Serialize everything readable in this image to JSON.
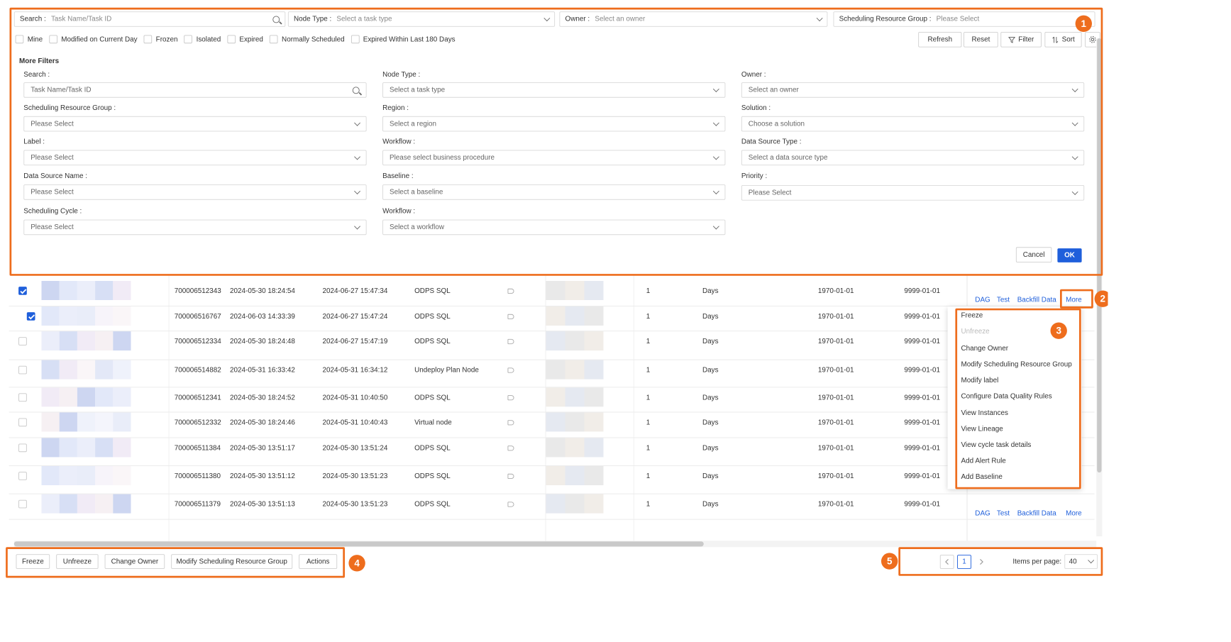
{
  "filters": {
    "search_label": "Search :",
    "search_placeholder": "Task Name/Task ID",
    "node_type_label": "Node Type :",
    "node_type_placeholder": "Select a task type",
    "owner_label": "Owner :",
    "owner_placeholder": "Select an owner",
    "resource_group_label": "Scheduling Resource Group :",
    "resource_group_placeholder": "Please Select"
  },
  "quick_filters": [
    {
      "label": "Mine",
      "checked": false
    },
    {
      "label": "Modified on Current Day",
      "checked": false
    },
    {
      "label": "Frozen",
      "checked": false
    },
    {
      "label": "Isolated",
      "checked": false
    },
    {
      "label": "Expired",
      "checked": false
    },
    {
      "label": "Normally Scheduled",
      "checked": false
    },
    {
      "label": "Expired Within Last 180 Days",
      "checked": false
    }
  ],
  "toolbar": {
    "refresh": "Refresh",
    "reset": "Reset",
    "filter": "Filter",
    "sort": "Sort"
  },
  "more_filters": {
    "title": "More Filters",
    "fields": [
      {
        "label": "Search :",
        "placeholder": "Task Name/Task ID"
      },
      {
        "label": "Node Type :",
        "placeholder": "Select a task type"
      },
      {
        "label": "Owner :",
        "placeholder": "Select an owner"
      },
      {
        "label": "Scheduling Resource Group :",
        "placeholder": "Please Select"
      },
      {
        "label": "Region :",
        "placeholder": "Select a region"
      },
      {
        "label": "Solution :",
        "placeholder": "Choose a solution"
      },
      {
        "label": "Label :",
        "placeholder": "Please Select"
      },
      {
        "label": "Workflow :",
        "placeholder": "Please select business procedure"
      },
      {
        "label": "Data Source Type :",
        "placeholder": "Select a data source type"
      },
      {
        "label": "Data Source Name :",
        "placeholder": "Please Select"
      },
      {
        "label": "Baseline :",
        "placeholder": "Select a baseline"
      },
      {
        "label": "Priority :",
        "placeholder": "Please Select"
      },
      {
        "label": "Scheduling Cycle :",
        "placeholder": "Please Select"
      },
      {
        "label": "Workflow :",
        "placeholder": "Select a workflow"
      }
    ],
    "cancel": "Cancel",
    "ok": "OK"
  },
  "rows": [
    {
      "checked": true,
      "id": "700006512343",
      "created": "2024-05-30 18:24:54",
      "modified": "2024-06-27 15:47:34",
      "type": "ODPS SQL",
      "priority": "1",
      "cycle": "Days",
      "start": "1970-01-01",
      "end": "9999-01-01"
    },
    {
      "checked": true,
      "id": "700006516767",
      "created": "2024-06-03 14:33:39",
      "modified": "2024-06-27 15:47:24",
      "type": "ODPS SQL",
      "priority": "1",
      "cycle": "Days",
      "start": "1970-01-01",
      "end": "9999-01-01"
    },
    {
      "checked": false,
      "id": "700006512334",
      "created": "2024-05-30 18:24:48",
      "modified": "2024-06-27 15:47:19",
      "type": "ODPS SQL",
      "priority": "1",
      "cycle": "Days",
      "start": "1970-01-01",
      "end": "9999-01-01"
    },
    {
      "checked": false,
      "id": "700006514882",
      "created": "2024-05-31 16:33:42",
      "modified": "2024-05-31 16:34:12",
      "type": "Undeploy Plan Node",
      "priority": "1",
      "cycle": "Days",
      "start": "1970-01-01",
      "end": "9999-01-01"
    },
    {
      "checked": false,
      "id": "700006512341",
      "created": "2024-05-30 18:24:52",
      "modified": "2024-05-31 10:40:50",
      "type": "ODPS SQL",
      "priority": "1",
      "cycle": "Days",
      "start": "1970-01-01",
      "end": "9999-01-01"
    },
    {
      "checked": false,
      "id": "700006512332",
      "created": "2024-05-30 18:24:46",
      "modified": "2024-05-31 10:40:43",
      "type": "Virtual node",
      "priority": "1",
      "cycle": "Days",
      "start": "1970-01-01",
      "end": "9999-01-01"
    },
    {
      "checked": false,
      "id": "700006511384",
      "created": "2024-05-30 13:51:17",
      "modified": "2024-05-30 13:51:24",
      "type": "ODPS SQL",
      "priority": "1",
      "cycle": "Days",
      "start": "1970-01-01",
      "end": "9999-01-01"
    },
    {
      "checked": false,
      "id": "700006511380",
      "created": "2024-05-30 13:51:12",
      "modified": "2024-05-30 13:51:23",
      "type": "ODPS SQL",
      "priority": "1",
      "cycle": "Days",
      "start": "1970-01-01",
      "end": "9999-01-01"
    },
    {
      "checked": false,
      "id": "700006511379",
      "created": "2024-05-30 13:51:13",
      "modified": "2024-05-30 13:51:23",
      "type": "ODPS SQL",
      "priority": "1",
      "cycle": "Days",
      "start": "1970-01-01",
      "end": "9999-01-01"
    }
  ],
  "row_actions": {
    "dag": "DAG",
    "test": "Test",
    "backfill": "Backfill Data",
    "more": "More"
  },
  "more_menu": [
    "Freeze",
    "Unfreeze",
    "Change Owner",
    "Modify Scheduling Resource Group",
    "Modify label",
    "Configure Data Quality Rules",
    "View Instances",
    "View Lineage",
    "View cycle task details",
    "Add Alert Rule",
    "Add Baseline"
  ],
  "bulk_actions": [
    "Freeze",
    "Unfreeze",
    "Change Owner",
    "Modify Scheduling Resource Group",
    "Actions"
  ],
  "pagination": {
    "current_page": "1",
    "items_per_page_label": "Items per page:",
    "items_per_page": "40"
  },
  "callouts": [
    "1",
    "2",
    "3",
    "4",
    "5"
  ],
  "colors": {
    "accent": "#1f5fdb",
    "callout": "#ee6d1d"
  }
}
